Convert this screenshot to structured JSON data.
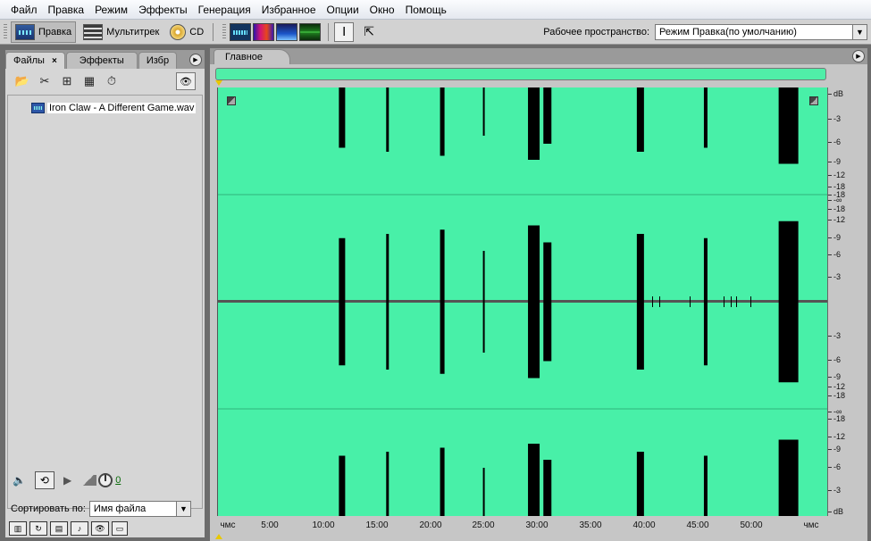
{
  "menu": [
    "Файл",
    "Правка",
    "Режим",
    "Эффекты",
    "Генерация",
    "Избранное",
    "Опции",
    "Окно",
    "Помощь"
  ],
  "toolbar": {
    "edit_label": "Правка",
    "multitrack_label": "Мультитрек",
    "cd_label": "CD",
    "view_buttons": [
      "waveform-view",
      "spectral-view",
      "spectral-pan-view",
      "phase-view"
    ],
    "tools": [
      "time-selection-tool",
      "marquee-tool"
    ],
    "workspace_label": "Рабочее пространство:",
    "workspace_value": "Режим Правка(по умолчанию)"
  },
  "left_panel": {
    "tabs": [
      {
        "label": "Файлы",
        "active": true
      },
      {
        "label": "Эффекты",
        "active": false
      },
      {
        "label": "Избр",
        "active": false
      }
    ],
    "files": [
      "Iron Claw - A Different Game.wav"
    ],
    "volume_value": "0",
    "sort_label": "Сортировать по:",
    "sort_value": "Имя файла"
  },
  "main_panel": {
    "tab_label": "Главное",
    "db_ruler": [
      "dB",
      "-3",
      "-6",
      "-9",
      "-12",
      "-18",
      "-18",
      "-∞",
      "-18",
      "-12",
      "-9",
      "-6",
      "-3",
      "-3",
      "-6",
      "-9",
      "-12",
      "-18",
      "-∞",
      "-18",
      "-12",
      "-9",
      "-6",
      "-3",
      "dB"
    ],
    "time_ruler": [
      "чмс",
      "5:00",
      "10:00",
      "15:00",
      "20:00",
      "25:00",
      "30:00",
      "35:00",
      "40:00",
      "45:00",
      "50:00",
      "чмс"
    ],
    "waveform_color": "#48f0a8",
    "bursts_minutes": [
      11.0,
      15.3,
      20.2,
      24.1,
      28.2,
      29.6,
      38.1,
      44.2,
      51.0
    ],
    "total_minutes": 55.5
  }
}
